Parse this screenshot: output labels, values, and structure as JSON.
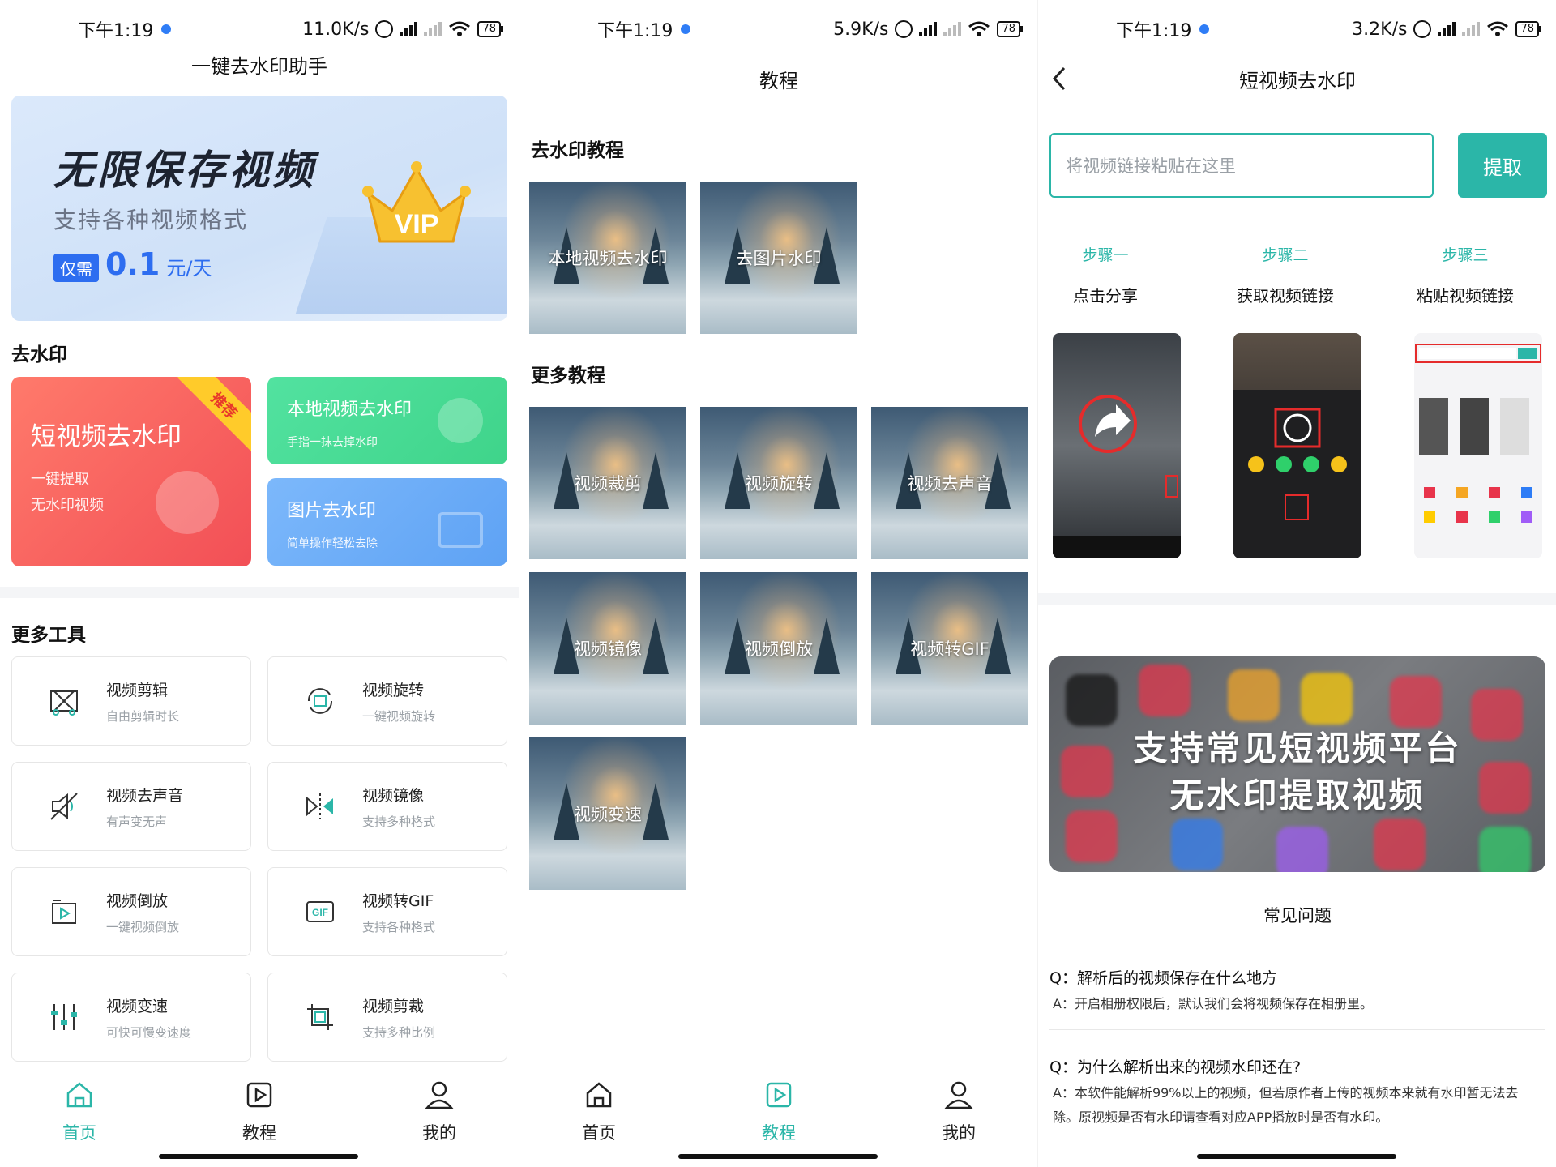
{
  "status": [
    {
      "time": "下午1:19",
      "speed": "11.0K/s",
      "battery": "78"
    },
    {
      "time": "下午1:19",
      "speed": "5.9K/s",
      "battery": "78"
    },
    {
      "time": "下午1:19",
      "speed": "3.2K/s",
      "battery": "78"
    }
  ],
  "home": {
    "title": "一键去水印助手",
    "banner": {
      "headline": "无限保存视频",
      "sub": "支持各种视频格式",
      "tag": "仅需",
      "price": "0.1",
      "unit": "元/天",
      "vip": "VIP"
    },
    "section1": "去水印",
    "card_main": {
      "title": "短视频去水印",
      "line1": "一键提取",
      "line2": "无水印视频",
      "ribbon": "推荐"
    },
    "card_local": {
      "title": "本地视频去水印",
      "sub": "手指一抹去掉水印"
    },
    "card_image": {
      "title": "图片去水印",
      "sub": "简单操作轻松去除"
    },
    "section2": "更多工具",
    "tools": [
      {
        "name": "视频剪辑",
        "desc": "自由剪辑时长",
        "icon": "scissors-icon"
      },
      {
        "name": "视频旋转",
        "desc": "一键视频旋转",
        "icon": "rotate-icon"
      },
      {
        "name": "视频去声音",
        "desc": "有声变无声",
        "icon": "mute-icon"
      },
      {
        "name": "视频镜像",
        "desc": "支持多种格式",
        "icon": "mirror-icon"
      },
      {
        "name": "视频倒放",
        "desc": "一键视频倒放",
        "icon": "reverse-icon"
      },
      {
        "name": "视频转GIF",
        "desc": "支持各种格式",
        "icon": "gif-icon"
      },
      {
        "name": "视频变速",
        "desc": "可快可慢变速度",
        "icon": "speed-icon"
      },
      {
        "name": "视频剪裁",
        "desc": "支持多种比例",
        "icon": "crop-icon"
      }
    ]
  },
  "nav": {
    "home": "首页",
    "tutorial": "教程",
    "mine": "我的"
  },
  "tutorial": {
    "title": "教程",
    "section1": "去水印教程",
    "items1": [
      "本地视频去水印",
      "去图片水印"
    ],
    "section2": "更多教程",
    "items2": [
      "视频裁剪",
      "视频旋转",
      "视频去声音",
      "视频镜像",
      "视频倒放",
      "视频转GIF",
      "视频变速"
    ]
  },
  "detail": {
    "title": "短视频去水印",
    "placeholder": "将视频链接粘贴在这里",
    "extract": "提取",
    "steps": [
      {
        "head": "步骤一",
        "desc": "点击分享"
      },
      {
        "head": "步骤二",
        "desc": "获取视频链接"
      },
      {
        "head": "步骤三",
        "desc": "粘贴视频链接"
      }
    ],
    "promo1": "支持常见短视频平台",
    "promo2": "无水印提取视频",
    "faq_title": "常见问题",
    "faqs": [
      {
        "q": "Q：解析后的视频保存在什么地方",
        "a": "A：开启相册权限后，默认我们会将视频保存在相册里。"
      },
      {
        "q": "Q：为什么解析出来的视频水印还在?",
        "a": "A：本软件能解析99%以上的视频，但若原作者上传的视频本来就有水印暂无法去除。原视频是否有水印请查看对应APP播放时是否有水印。"
      }
    ]
  },
  "colors": {
    "accent": "#2bb6a8",
    "red": "#f25a5a",
    "green": "#48dd8c",
    "blue": "#6aaaf5"
  }
}
